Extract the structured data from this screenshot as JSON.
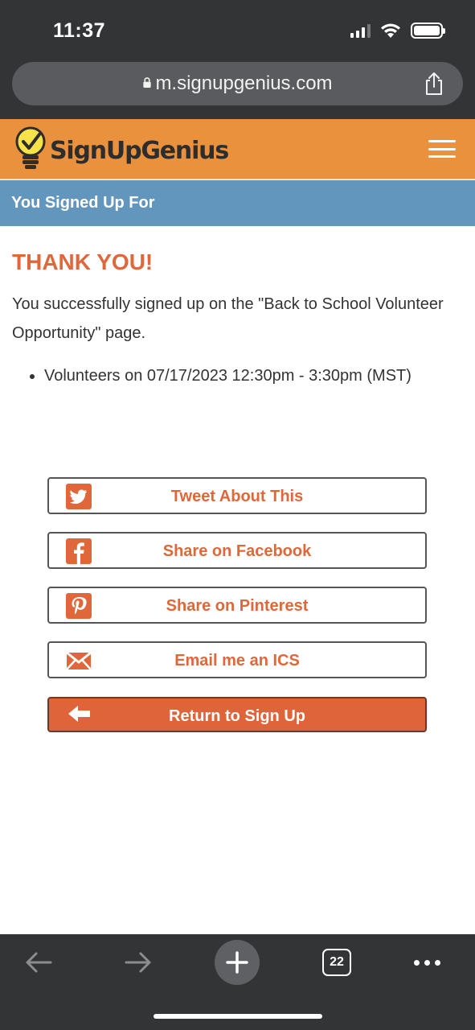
{
  "status_bar": {
    "time": "11:37"
  },
  "browser": {
    "url": "m.signupgenius.com",
    "tab_count": "22"
  },
  "site": {
    "logo_text": "SignUpGenius",
    "brand_color": "#e9913d",
    "accent_color": "#e0673a",
    "section_bar_color": "#6396bd"
  },
  "section_title": "You Signed Up For",
  "confirmation": {
    "heading": "THANK YOU!",
    "message": "You successfully signed up on the \"Back to School Volunteer Opportunity\" page.",
    "slots": [
      "Volunteers on 07/17/2023 12:30pm - 3:30pm (MST)"
    ]
  },
  "actions": {
    "tweet": {
      "label": "Tweet About This",
      "icon": "twitter-icon"
    },
    "facebook": {
      "label": "Share on Facebook",
      "icon": "facebook-icon"
    },
    "pinterest": {
      "label": "Share on Pinterest",
      "icon": "pinterest-icon"
    },
    "email_ics": {
      "label": "Email me an ICS",
      "icon": "envelope-icon"
    },
    "return": {
      "label": "Return to Sign Up",
      "icon": "arrow-left-icon"
    }
  }
}
